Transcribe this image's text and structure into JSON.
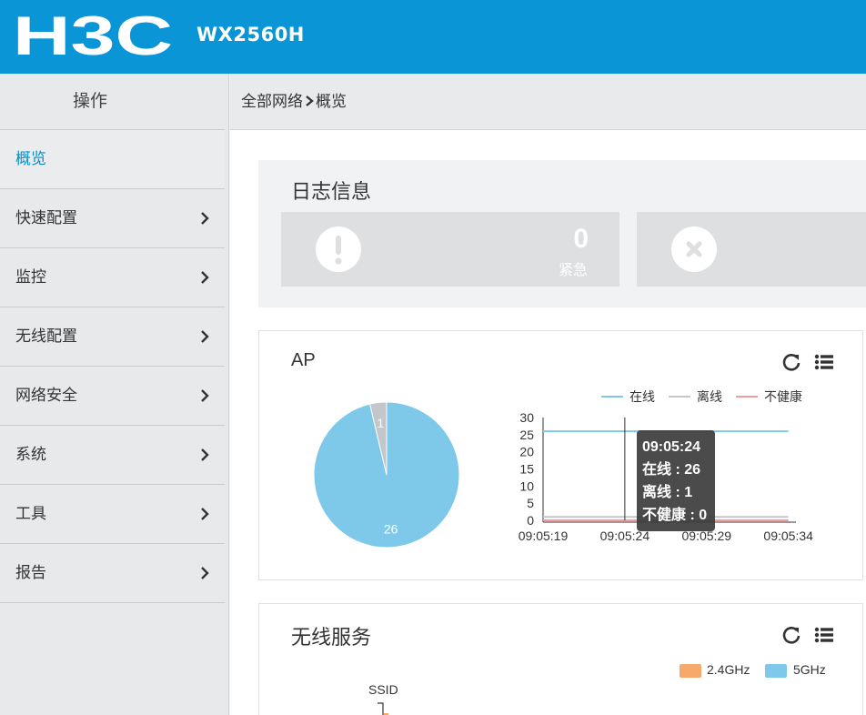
{
  "header": {
    "brand": "H3C",
    "model": "WX2560H"
  },
  "sidebar": {
    "title": "操作",
    "items": [
      {
        "label": "概览",
        "active": true
      },
      {
        "label": "快速配置"
      },
      {
        "label": "监控"
      },
      {
        "label": "无线配置"
      },
      {
        "label": "网络安全"
      },
      {
        "label": "系统"
      },
      {
        "label": "工具"
      },
      {
        "label": "报告"
      }
    ]
  },
  "breadcrumb": {
    "root": "全部网络",
    "current": "概览"
  },
  "log_info": {
    "title": "日志信息",
    "cards": [
      {
        "icon": "exclamation-icon",
        "count": "0",
        "label": "紧急"
      },
      {
        "icon": "close-circle-icon",
        "count": "",
        "label": ""
      }
    ]
  },
  "ap_panel": {
    "title": "AP",
    "tools": [
      "refresh-icon",
      "list-icon"
    ],
    "tooltip": {
      "time": "09:05:24",
      "online": "在线 : 26",
      "offline": "离线 : 1",
      "unhealthy": "不健康 : 0"
    }
  },
  "wireless_service": {
    "title": "无线服务",
    "tools": [
      "refresh-icon",
      "list-icon"
    ],
    "legend": [
      "2.4GHz",
      "5GHz"
    ],
    "axis_label": "SSID"
  },
  "colors": {
    "header": "#0a96d6",
    "online": "#7ec8ea",
    "offline": "#c3c6cb",
    "unhealthy": "#f29b9b",
    "band_24": "#f5a96b",
    "band_5": "#7ec8ea",
    "active_nav": "#0a8ccf"
  },
  "chart_data": [
    {
      "type": "pie",
      "labels": [
        "在线",
        "离线"
      ],
      "values": [
        26,
        1
      ],
      "colors": [
        "#7ec8ea",
        "#c3c6cb"
      ]
    },
    {
      "type": "line",
      "x": [
        "09:05:19",
        "09:05:24",
        "09:05:29",
        "09:05:34"
      ],
      "xticks": [
        "09:05:19",
        "09:05:24",
        "09:05:29",
        "09:05:34"
      ],
      "yticks": [
        0,
        5,
        10,
        15,
        20,
        25,
        30
      ],
      "ylim": [
        0,
        30
      ],
      "legend_position": "top-right",
      "series": [
        {
          "name": "在线",
          "values": [
            26,
            26,
            26,
            26
          ],
          "color": "#7ec8ea"
        },
        {
          "name": "离线",
          "values": [
            1,
            1,
            1,
            1
          ],
          "color": "#c3c6cb"
        },
        {
          "name": "不健康",
          "values": [
            0,
            0,
            0,
            0
          ],
          "color": "#f29b9b"
        }
      ]
    }
  ]
}
